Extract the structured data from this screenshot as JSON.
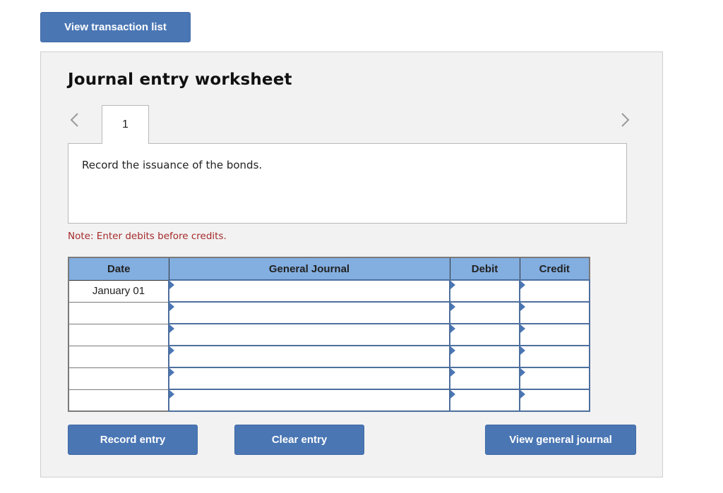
{
  "toolbar": {
    "view_transaction_list": "View transaction list"
  },
  "worksheet": {
    "title": "Journal entry worksheet",
    "nav": {
      "prev_icon": "chevron-left-icon",
      "next_icon": "chevron-right-icon"
    },
    "tabs": [
      {
        "label": "1",
        "active": true
      }
    ],
    "prompt": "Record the issuance of the bonds.",
    "note": "Note: Enter debits before credits.",
    "table": {
      "headers": [
        "Date",
        "General Journal",
        "Debit",
        "Credit"
      ],
      "rows": [
        {
          "date": "January 01",
          "account": "",
          "debit": "",
          "credit": ""
        },
        {
          "date": "",
          "account": "",
          "debit": "",
          "credit": ""
        },
        {
          "date": "",
          "account": "",
          "debit": "",
          "credit": ""
        },
        {
          "date": "",
          "account": "",
          "debit": "",
          "credit": ""
        },
        {
          "date": "",
          "account": "",
          "debit": "",
          "credit": ""
        },
        {
          "date": "",
          "account": "",
          "debit": "",
          "credit": ""
        }
      ]
    },
    "buttons": {
      "record_entry": "Record entry",
      "clear_entry": "Clear entry",
      "view_general_journal": "View general journal"
    }
  },
  "colors": {
    "button": "#4a76b4",
    "header": "#82aee0",
    "note": "#a52a2a",
    "panel": "#f2f2f2"
  }
}
